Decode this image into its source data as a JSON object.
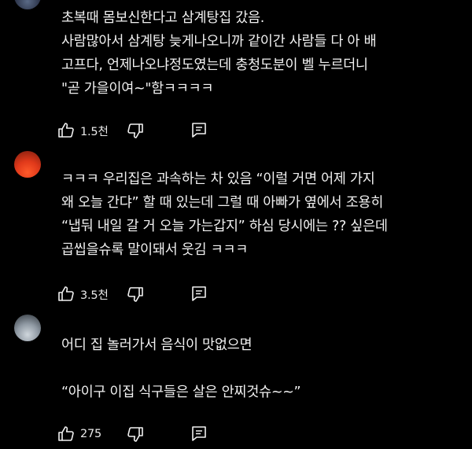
{
  "comments": [
    {
      "lines": [
        "초복때 몸보신한다고 삼계탕집 갔음.",
        "사람많아서 삼계탕 늦게나오니까 같이간 사람들 다 아 배",
        "고프다, 언제나오냐정도였는데 충청도분이 벨 누르더니",
        "\"곧 가을이여~\"함ㅋㅋㅋㅋ"
      ],
      "like_count": "1.5천",
      "icons": {
        "like": "thumbs-up-icon",
        "dislike": "thumbs-down-icon",
        "reply": "reply-icon"
      }
    },
    {
      "lines": [
        "ㅋㅋㅋ 우리집은 과속하는 차 있음 “이럴 거면 어제 가지",
        "왜 오늘 간댜” 할 때 있는데 그럴 때 아빠가 옆에서 조용히",
        "“냅둬 내일 갈 거 오늘 가는갑지” 하심 당시에는 ?? 싶은데",
        "곱씹을슈록 말이돼서 웃김 ㅋㅋㅋ"
      ],
      "like_count": "3.5천",
      "icons": {
        "like": "thumbs-up-icon",
        "dislike": "thumbs-down-icon",
        "reply": "reply-icon"
      }
    },
    {
      "lines": [
        "어디 집 놀러가서 음식이 맛없으면",
        "",
        "“아이구 이집 식구들은 살은 안찌것슈~~”"
      ],
      "like_count": "275",
      "icons": {
        "like": "thumbs-up-icon",
        "dislike": "thumbs-down-icon",
        "reply": "reply-icon"
      }
    }
  ]
}
